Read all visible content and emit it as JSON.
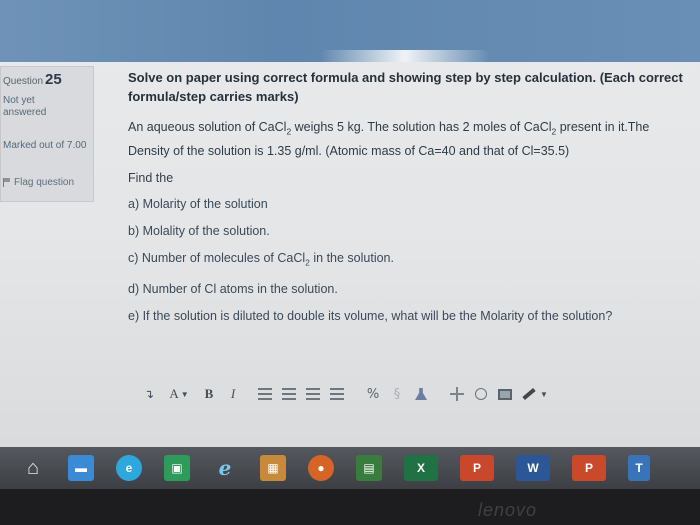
{
  "question_info": {
    "label": "Question",
    "number": "25",
    "state": "Not yet answered",
    "marks": "Marked out of 7.00",
    "flag_label": "Flag question"
  },
  "question": {
    "instruction": "Solve on paper using correct formula and showing step by step calculation. (Each correct formula/step carries marks)",
    "para_1": "An aqueous solution of CaCl",
    "para_1_sub": "2",
    "para_2": " weighs 5 kg. The solution has 2 moles of CaCl",
    "para_2_sub": "2",
    "para_3": " present in it.The Density of the solution is 1.35 g/ml. (Atomic mass of Ca=40 and that of Cl=35.5)",
    "find": "Find the",
    "part_a": "a) Molarity of the solution",
    "part_b": "b) Molality of the solution.",
    "part_c_1": "c) Number of molecules of CaCl",
    "part_c_sub": "2",
    "part_c_2": " in the solution.",
    "part_d": "d) Number of Cl atoms in the solution.",
    "part_e": "e) If the solution is diluted to double its volume, what will be the Molarity of the solution?"
  },
  "toolbar": {
    "font_size_label": "A",
    "bold_label": "B",
    "italic_label": "I"
  },
  "taskbar": {
    "excel_label": "X",
    "powerpoint_label": "P",
    "word_label": "W",
    "publisher_label": "P",
    "t_label": "T"
  },
  "bezel": {
    "brand": "lenovo"
  }
}
